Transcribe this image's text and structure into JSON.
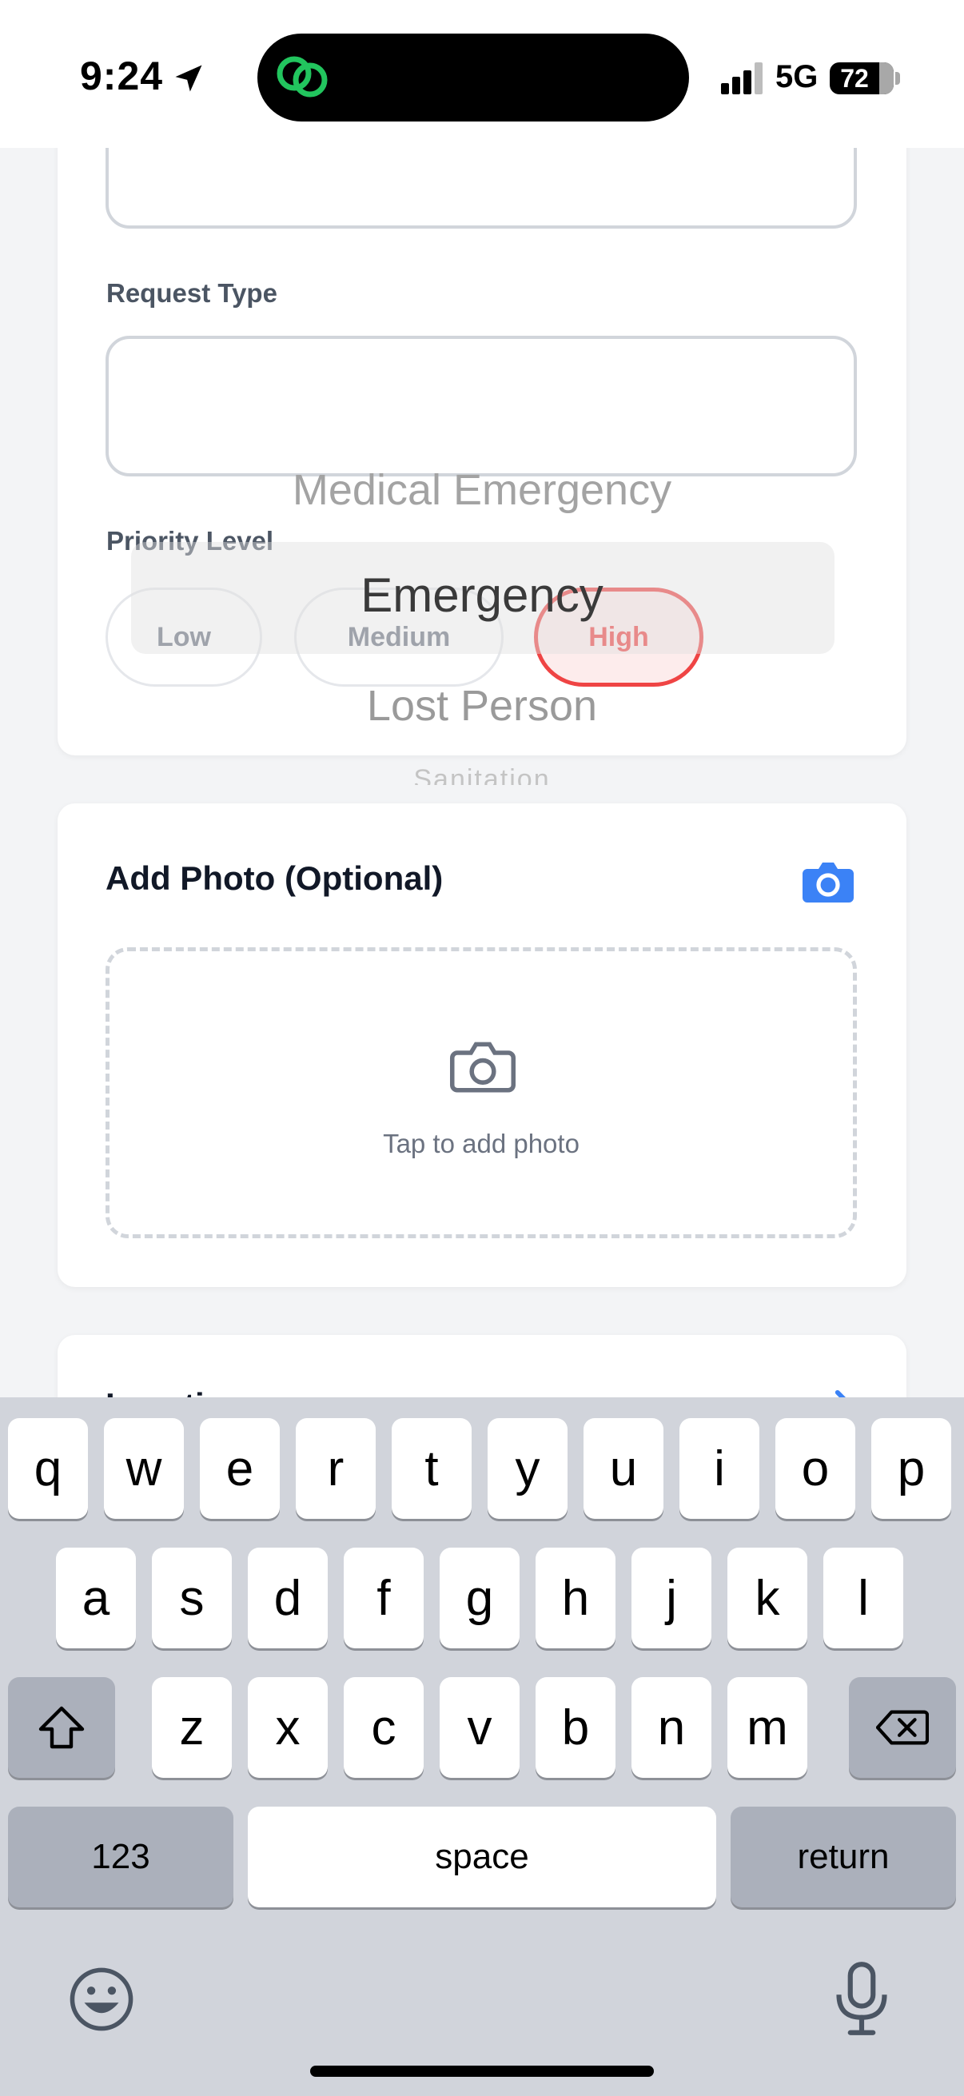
{
  "status_bar": {
    "time": "9:24",
    "network": "5G",
    "battery": "72"
  },
  "form": {
    "request_type_label": "Request Type",
    "priority_label": "Priority Level",
    "priority_options": [
      "Low",
      "Medium",
      "High"
    ],
    "priority_selected": "High",
    "picker_options": [
      "Medical Emergency",
      "Emergency",
      "Lost Person",
      "Sanitation"
    ],
    "picker_selected": "Emergency"
  },
  "photo": {
    "title": "Add Photo (Optional)",
    "hint": "Tap to add photo"
  },
  "location": {
    "title": "Location"
  },
  "keyboard": {
    "row1": [
      "q",
      "w",
      "e",
      "r",
      "t",
      "y",
      "u",
      "i",
      "o",
      "p"
    ],
    "row2": [
      "a",
      "s",
      "d",
      "f",
      "g",
      "h",
      "j",
      "k",
      "l"
    ],
    "row3": [
      "z",
      "x",
      "c",
      "v",
      "b",
      "n",
      "m"
    ],
    "numbers_label": "123",
    "space_label": "space",
    "return_label": "return"
  },
  "colors": {
    "accent": "#3b82f6",
    "priority_high": "#ef4444"
  },
  "icons": [
    "location-arrow-icon",
    "app-link-icon",
    "signal-icon",
    "camera-icon",
    "arrow-icon",
    "shift-icon",
    "delete-icon",
    "emoji-icon",
    "microphone-icon"
  ]
}
